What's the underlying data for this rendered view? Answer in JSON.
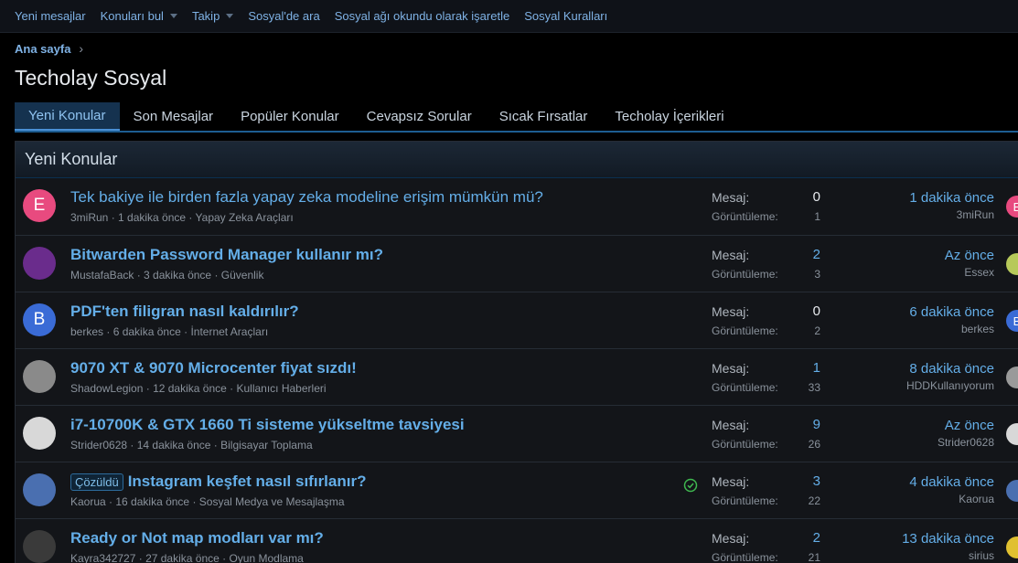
{
  "topnav": {
    "items": [
      {
        "label": "Yeni mesajlar"
      },
      {
        "label": "Konuları bul",
        "dropdown": true
      },
      {
        "label": "Takip",
        "dropdown": true
      },
      {
        "label": "Sosyal'de ara"
      },
      {
        "label": "Sosyal ağı okundu olarak işaretle"
      },
      {
        "label": "Sosyal Kuralları"
      }
    ]
  },
  "breadcrumb": {
    "home": "Ana sayfa"
  },
  "page": {
    "title": "Techolay Sosyal"
  },
  "tabs": [
    {
      "label": "Yeni Konular",
      "active": true
    },
    {
      "label": "Son Mesajlar"
    },
    {
      "label": "Popüler Konular"
    },
    {
      "label": "Cevapsız Sorular"
    },
    {
      "label": "Sıcak Fırsatlar"
    },
    {
      "label": "Techolay İçerikleri"
    }
  ],
  "block": {
    "title": "Yeni Konular"
  },
  "labels": {
    "messages": "Mesaj:",
    "views": "Görüntüleme:",
    "meta_sep": " · "
  },
  "threads": [
    {
      "title": "Tek bakiye ile birden fazla yapay zeka modeline erişim mümkün mü?",
      "bold": false,
      "author": "3miRun",
      "time": "1 dakika önce",
      "forum": "Yapay Zeka Araçları",
      "messages": "0",
      "views": "1",
      "last_time": "1 dakika önce",
      "last_user": "3miRun",
      "avatar_letter": "E",
      "avatar_color": "#e84a7f",
      "mini_letter": "E",
      "mini_color": "#e84a7f"
    },
    {
      "title": "Bitwarden Password Manager kullanır mı?",
      "bold": true,
      "author": "MustafaBack",
      "time": "3 dakika önce",
      "forum": "Güvenlik",
      "messages": "2",
      "views": "3",
      "last_time": "Az önce",
      "last_user": "Essex",
      "avatar_letter": "",
      "avatar_color": "#6a2c8c",
      "mini_letter": "",
      "mini_color": "#b7c95a"
    },
    {
      "title": "PDF'ten filigran nasıl kaldırılır?",
      "bold": true,
      "author": "berkes",
      "time": "6 dakika önce",
      "forum": "İnternet Araçları",
      "messages": "0",
      "views": "2",
      "last_time": "6 dakika önce",
      "last_user": "berkes",
      "avatar_letter": "B",
      "avatar_color": "#3a6bd6",
      "mini_letter": "B",
      "mini_color": "#3a6bd6"
    },
    {
      "title": "9070 XT & 9070 Microcenter fiyat sızdı!",
      "bold": true,
      "author": "ShadowLegion",
      "time": "12 dakika önce",
      "forum": "Kullanıcı Haberleri",
      "messages": "1",
      "views": "33",
      "last_time": "8 dakika önce",
      "last_user": "HDDKullanıyorum",
      "avatar_letter": "",
      "avatar_color": "#8a8a8a",
      "mini_letter": "",
      "mini_color": "#9a9a9a"
    },
    {
      "title": "i7-10700K & GTX 1660 Ti sisteme yükseltme tavsiyesi",
      "bold": true,
      "author": "Strider0628",
      "time": "14 dakika önce",
      "forum": "Bilgisayar Toplama",
      "messages": "9",
      "views": "26",
      "last_time": "Az önce",
      "last_user": "Strider0628",
      "avatar_letter": "",
      "avatar_color": "#d8d8d8",
      "mini_letter": "",
      "mini_color": "#d8d8d8"
    },
    {
      "title": "Instagram keşfet nasıl sıfırlanır?",
      "bold": true,
      "prefix": "Çözüldü",
      "solved": true,
      "author": "Kaorua",
      "time": "16 dakika önce",
      "forum": "Sosyal Medya ve Mesajlaşma",
      "messages": "3",
      "views": "22",
      "last_time": "4 dakika önce",
      "last_user": "Kaorua",
      "avatar_letter": "",
      "avatar_color": "#4a6fb0",
      "mini_letter": "",
      "mini_color": "#4a6fb0"
    },
    {
      "title": "Ready or Not map modları var mı?",
      "bold": true,
      "author": "Kayra342727",
      "time": "27 dakika önce",
      "forum": "Oyun Modlama",
      "messages": "2",
      "views": "21",
      "last_time": "13 dakika önce",
      "last_user": "sirius",
      "avatar_letter": "",
      "avatar_color": "#3a3a3a",
      "mini_letter": "",
      "mini_color": "#e0c030"
    }
  ]
}
